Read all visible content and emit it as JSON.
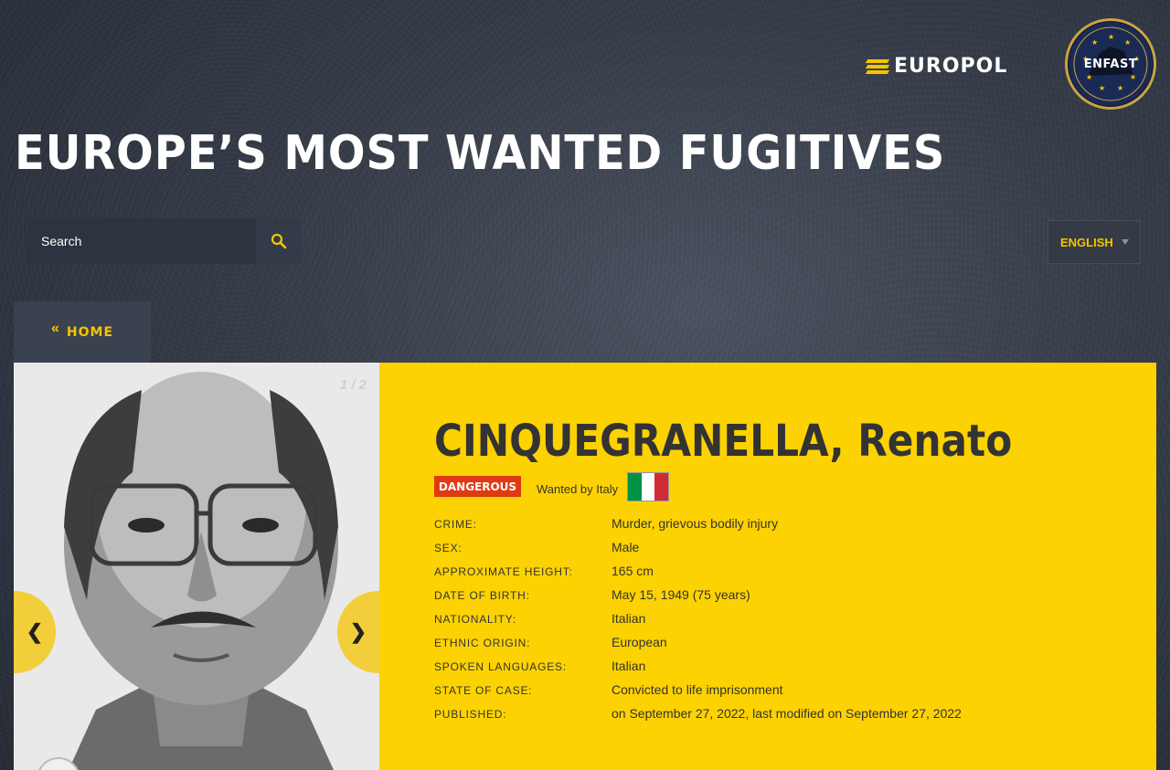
{
  "header": {
    "europol_logo_text": "EUROPOL",
    "enfast_badge_text": "ENFAST",
    "page_title": "EUROPE’S MOST WANTED FUGITIVES"
  },
  "search": {
    "placeholder": "Search",
    "icon": "search-icon"
  },
  "language": {
    "selected": "ENGLISH"
  },
  "nav": {
    "home_label": "HOME",
    "home_chevron": "«"
  },
  "gallery": {
    "counter": "1 / 2",
    "prev_label": "❮",
    "next_label": "❯"
  },
  "fugitive": {
    "name": "CINQUEGRANELLA, Renato",
    "badge": "DANGEROUS",
    "wanted_by": "Wanted by Italy",
    "flag_colors": [
      "#009246",
      "#ffffff",
      "#ce2b37"
    ],
    "details": [
      {
        "label": "CRIME:",
        "value": "Murder, grievous bodily injury"
      },
      {
        "label": "SEX:",
        "value": "Male"
      },
      {
        "label": "APPROXIMATE HEIGHT:",
        "value": "165 cm"
      },
      {
        "label": "DATE OF BIRTH:",
        "value": "May 15, 1949 (75 years)"
      },
      {
        "label": "NATIONALITY:",
        "value": "Italian"
      },
      {
        "label": "ETHNIC ORIGIN:",
        "value": "European"
      },
      {
        "label": "SPOKEN LANGUAGES:",
        "value": "Italian"
      },
      {
        "label": "STATE OF CASE:",
        "value": "Convicted to life imprisonment"
      },
      {
        "label": "PUBLISHED:",
        "value": "on September 27, 2022, last modified on September 27, 2022"
      }
    ]
  },
  "colors": {
    "accent_yellow": "#fdd202",
    "danger_red": "#e03a12",
    "background": "#353c48"
  }
}
